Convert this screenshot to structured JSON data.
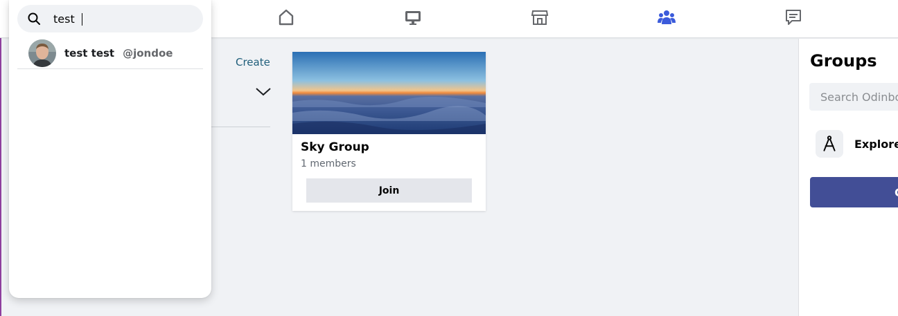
{
  "search": {
    "query": "test",
    "results": [
      {
        "name": "test test",
        "handle": "@jondoe"
      }
    ]
  },
  "nav": {
    "icons": [
      "home-icon",
      "watch-icon",
      "marketplace-icon",
      "groups-icon",
      "feed-icon"
    ],
    "active": "groups-icon",
    "active_color": "#3b5bdb"
  },
  "main": {
    "create_link": "Create"
  },
  "group_card": {
    "name": "Sky Group",
    "members": "1 members",
    "join_label": "Join"
  },
  "sidebar": {
    "title": "Groups",
    "search_placeholder": "Search Odinbook",
    "explore_label": "Explore",
    "create_button_label": "C",
    "button_color": "#424e96"
  }
}
